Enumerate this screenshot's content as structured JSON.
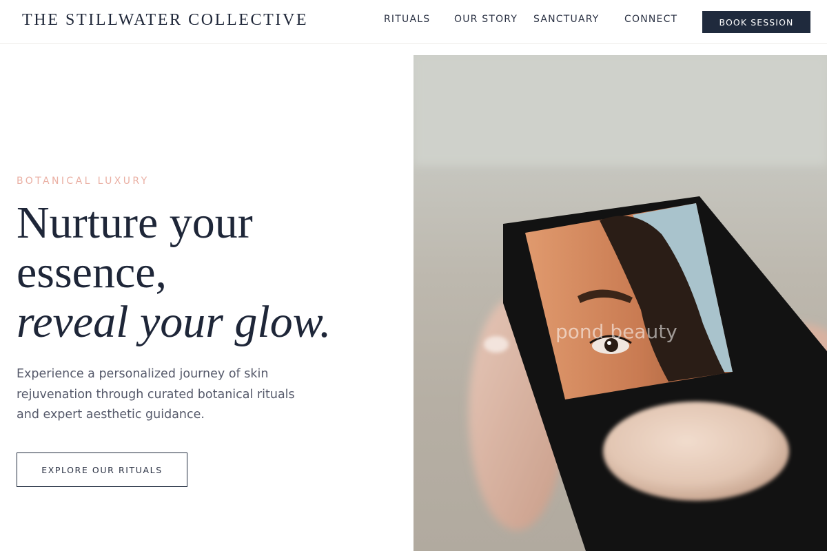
{
  "header": {
    "brand": "THE STILLWATER COLLECTIVE",
    "nav": [
      {
        "label": "RITUALS"
      },
      {
        "label": "OUR STORY"
      },
      {
        "label": "SANCTUARY"
      },
      {
        "label": "CONNECT"
      }
    ],
    "book_label": "BOOK SESSION"
  },
  "hero": {
    "eyebrow": "BOTANICAL LUXURY",
    "headline": {
      "line1": "Nurture your",
      "line2": "essence,",
      "line3": "reveal your glow."
    },
    "description": "Experience a personalized journey of skin rejuvenation through curated botanical rituals and expert aesthetic guidance.",
    "cta_label": "EXPLORE OUR RITUALS",
    "image": {
      "watermark": "pond beauty"
    }
  },
  "colors": {
    "navy": "#1f2a3d",
    "accent_blush": "#eab0a4",
    "body_text": "#55596a"
  },
  "icons": []
}
